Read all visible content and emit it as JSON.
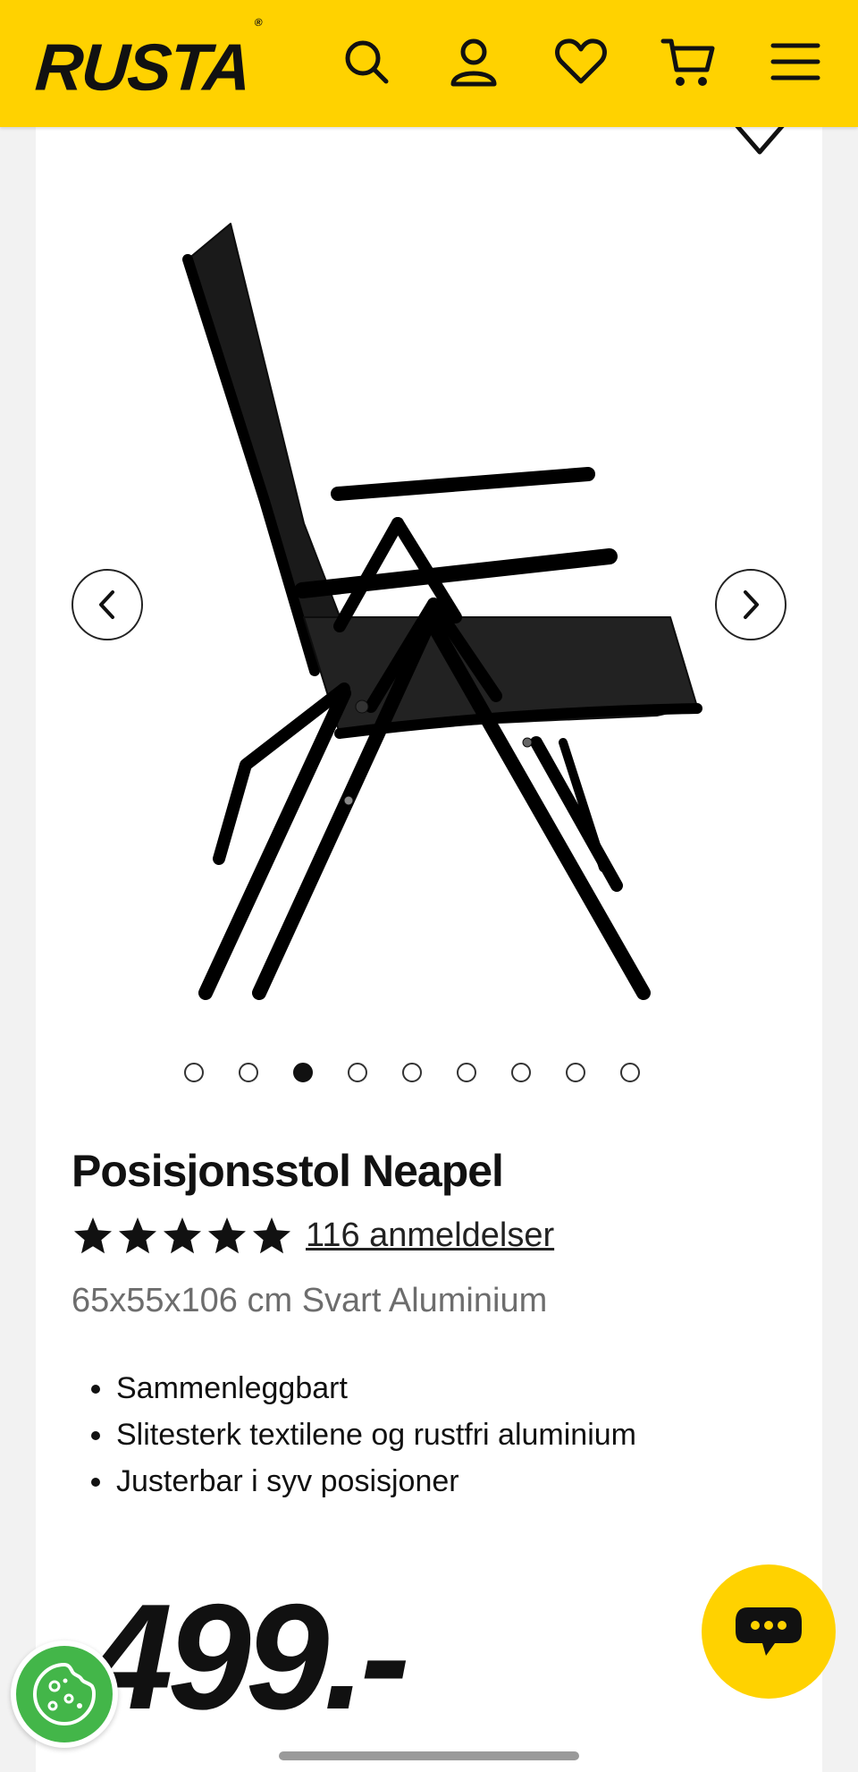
{
  "header": {
    "logo_text": "RUSTA",
    "logo_mark": "®",
    "icons": [
      "search-icon",
      "account-icon",
      "wishlist-icon",
      "cart-icon",
      "menu-icon"
    ]
  },
  "gallery": {
    "image_alt": "Posisjonsstol Neapel",
    "total_images": 9,
    "active_index": 2
  },
  "product": {
    "title": "Posisjonsstol Neapel",
    "rating": 5,
    "reviews_label": "116 anmeldelser",
    "subtitle": "65x55x106 cm Svart Aluminium",
    "features": [
      "Sammenleggbart",
      "Slitesterk textilene og rustfri aluminium",
      "Justerbar i syv posisjoner"
    ],
    "price": "499.-"
  },
  "colors": {
    "brand_yellow": "#ffd200",
    "cookie_green": "#43b649"
  }
}
